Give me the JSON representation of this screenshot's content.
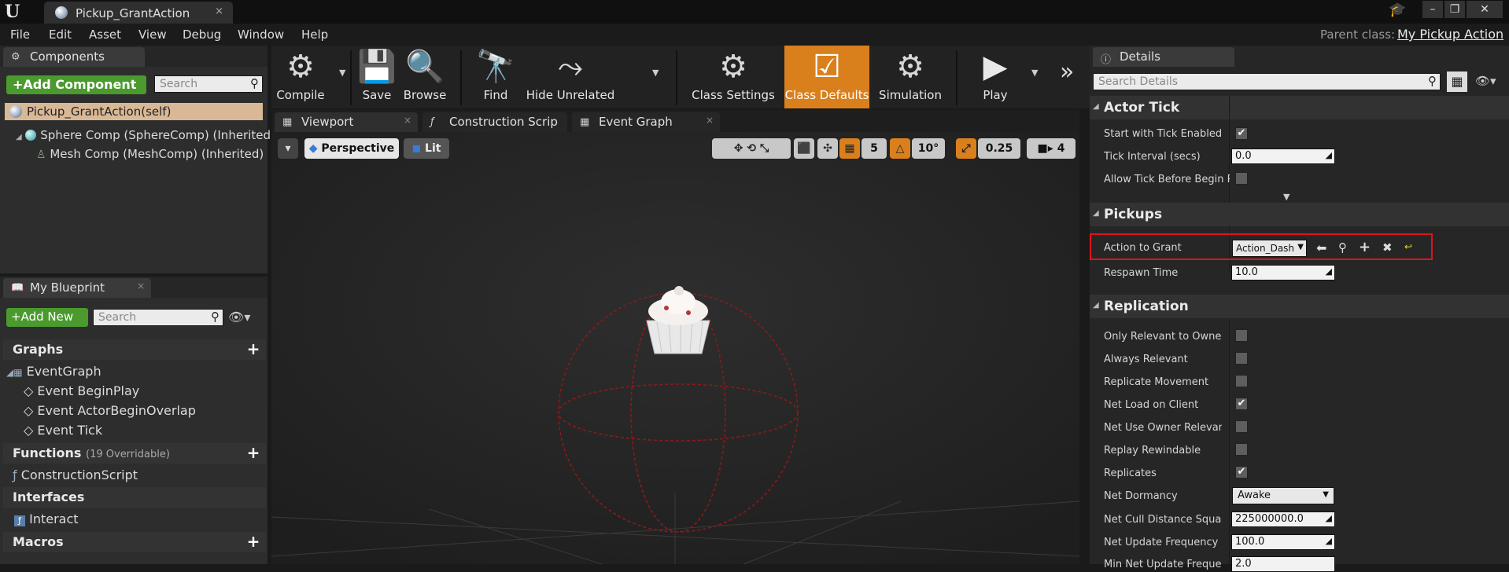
{
  "window": {
    "tab_title": "Pickup_GrantAction",
    "close_glyph": "×",
    "buttons": [
      "–",
      "❐",
      "✕"
    ]
  },
  "menu": {
    "items": [
      "File",
      "Edit",
      "Asset",
      "View",
      "Debug",
      "Window",
      "Help"
    ],
    "parent_class_label": "Parent class:",
    "parent_class_value": "My Pickup Action"
  },
  "components": {
    "tab_label": "Components",
    "add_button": "+Add Component",
    "search_placeholder": "Search",
    "self_label": "Pickup_GrantAction(self)",
    "children": [
      "Sphere Comp (SphereComp) (Inherited)",
      "Mesh Comp (MeshComp) (Inherited)"
    ]
  },
  "my_blueprint": {
    "tab_label": "My Blueprint",
    "add_new": "+Add New",
    "search_placeholder": "Search",
    "graphs_label": "Graphs",
    "graph_items": [
      "EventGraph",
      "Event BeginPlay",
      "Event ActorBeginOverlap",
      "Event Tick"
    ],
    "functions_label": "Functions",
    "functions_count": "(19 Overridable)",
    "function_items": [
      "ConstructionScript"
    ],
    "interfaces_label": "Interfaces",
    "interface_items": [
      "Interact"
    ],
    "macros_label": "Macros"
  },
  "toolbar": {
    "buttons": [
      "Compile",
      "Save",
      "Browse",
      "Find",
      "Hide Unrelated",
      "Class Settings",
      "Class Defaults",
      "Simulation",
      "Play"
    ],
    "active": "Class Defaults",
    "more_glyph": "»"
  },
  "editor_tabs": [
    "Viewport",
    "Construction Scrip",
    "Event Graph"
  ],
  "viewport": {
    "perspective": "Perspective",
    "lit": "Lit",
    "grid_snap": "5",
    "rotation_snap": "10°",
    "scale_snap": "0.25",
    "camera_speed": "4"
  },
  "details": {
    "tab_label": "Details",
    "search_placeholder": "Search Details",
    "actor_tick": {
      "title": "Actor Tick",
      "start_with_tick_label": "Start with Tick Enabled",
      "start_with_tick": true,
      "tick_interval_label": "Tick Interval (secs)",
      "tick_interval": "0.0",
      "allow_tick_label": "Allow Tick Before Begin Play",
      "allow_tick": false
    },
    "pickups": {
      "title": "Pickups",
      "action_label": "Action to Grant",
      "action_value": "Action_Dash",
      "respawn_label": "Respawn Time",
      "respawn_value": "10.0"
    },
    "replication": {
      "title": "Replication",
      "rows": [
        {
          "label": "Only Relevant to Owner",
          "checked": false
        },
        {
          "label": "Always Relevant",
          "checked": false
        },
        {
          "label": "Replicate Movement",
          "checked": false
        },
        {
          "label": "Net Load on Client",
          "checked": true
        },
        {
          "label": "Net Use Owner Relevancy",
          "checked": false
        },
        {
          "label": "Replay Rewindable",
          "checked": false
        },
        {
          "label": "Replicates",
          "checked": true
        }
      ],
      "dormancy_label": "Net Dormancy",
      "dormancy_value": "Awake",
      "cull_label": "Net Cull Distance Squared",
      "cull_value": "225000000.0",
      "update_label": "Net Update Frequency",
      "update_value": "100.0",
      "min_update_label": "Min Net Update Frequency",
      "min_update_value": "2.0"
    }
  }
}
